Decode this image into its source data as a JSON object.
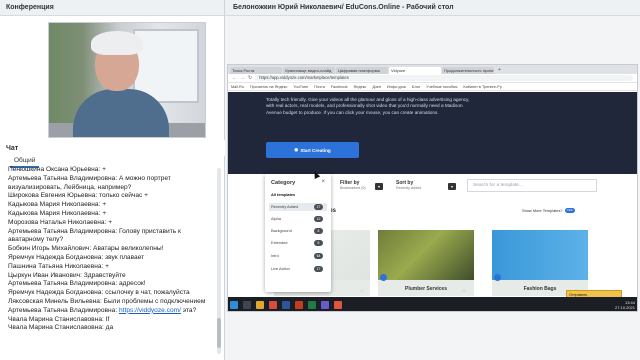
{
  "left": {
    "conference_title": "Конференция",
    "chat_title": "Чат",
    "chat_tab": "Общий",
    "messages": [
      {
        "author": "Пенюшкина Оксана Юрьевна:",
        "text": " +"
      },
      {
        "author": "Артемьева Татьяна  Владимировна:",
        "text": " А можно портрет визуализировать, Лейбница, например?"
      },
      {
        "author": "Широкова Евгения Юрьевна:",
        "text": " только сейчас +"
      },
      {
        "author": "Кадыкова Мария Николаевна:",
        "text": " +"
      },
      {
        "author": "Кадыкова Мария Николаевна:",
        "text": " +"
      },
      {
        "author": "Морозова Наталья Николаевна:",
        "text": " +"
      },
      {
        "author": "Артемьева Татьяна  Владимировна:",
        "text": " Голову приставить к аватарному телу?"
      },
      {
        "author": "Бобкин Игорь  Михайлович:",
        "text": " Аватары великолепны!"
      },
      {
        "author": "Яремчук Надежда Богдановна:",
        "text": " звук плавает"
      },
      {
        "author": "Пашнина Татьяна Николаевна:",
        "text": " +"
      },
      {
        "author": "Цыркун Иван  Иванович:",
        "text": " Здравствуйте"
      },
      {
        "author": "Артемьева Татьяна  Владимировна:",
        "text": " адресок!"
      },
      {
        "author": "Яремчук Надежда Богдановна:",
        "text": " ссылочку в чат, пожалуйста"
      },
      {
        "author": "Ляксовская Минель Вильевна:",
        "text": " Были проблемы с подключением"
      },
      {
        "author": "Артемьева Татьяна  Владимировна:",
        "text": " ",
        "link": "https://viddyoze.com/",
        "after": "  эта?"
      },
      {
        "author": "Чвала Марина Станиславовна:",
        "text": " If"
      },
      {
        "author": "Чвала Марина Станиславовна:",
        "text": " да"
      }
    ]
  },
  "right": {
    "share_title": "Белоножкин Юрий Николаевич/ EduCons.Online - Рабочий стол",
    "browser": {
      "tabs": [
        "Точка Роста",
        "Хранилище видео-слайд",
        "Цифровая платформа",
        "Vidyoze",
        "Продолжительность проекта"
      ],
      "new_tab": "+",
      "url": "https://app.viddyoze.com/marketplace/templates",
      "bookmarks": [
        "Mail.Ru",
        "Прочитать на Яндекс",
        "YouTube",
        "Почта",
        "Facebook",
        "Яндекс",
        "Дзен",
        "Инфо-урок",
        "Блог",
        "Учебные пособия",
        "Кабинет в Тренинг-Ру"
      ]
    },
    "hero_text": "Totally tech friendly. Give your videos all the glamour and gloss of a high-class advertising agency, with real actors, real models, and professionally shot video that you'd normally need a Madison Avenue budget to produce. If you can click your mouse, you can create animations.",
    "start_button": "Start Creating",
    "filter_by_label": "Filter by",
    "filter_by_value": "Bookmarked (0)",
    "sort_by_label": "Sort by",
    "sort_by_value": "Recently Added",
    "search_placeholder": "Search for a template...",
    "templates_heading": "ates",
    "show_more_label": "Show More Templates?",
    "show_more_toggle": "YES",
    "category": {
      "title": "Category",
      "close": "×",
      "items": [
        {
          "label": "All templates",
          "count": ""
        },
        {
          "label": "Recently Added",
          "count": "27"
        },
        {
          "label": "Alpha",
          "count": "12"
        },
        {
          "label": "Background",
          "count": "8"
        },
        {
          "label": "Extended",
          "count": "5"
        },
        {
          "label": "Intro",
          "count": "64"
        },
        {
          "label": "Live Action",
          "count": "17"
        }
      ]
    },
    "cards": [
      {
        "name": ""
      },
      {
        "name": "Plumber Services"
      },
      {
        "name": "Fashion Bags"
      }
    ],
    "yellow_popup": "Отправить",
    "clock": {
      "time": "13:44",
      "date": "27.10.2021"
    }
  }
}
